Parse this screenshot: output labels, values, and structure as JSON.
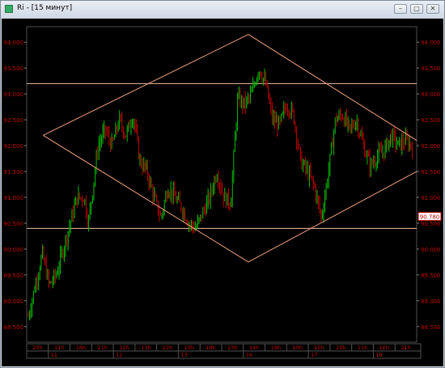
{
  "window": {
    "title": "Ri - [15 минут]",
    "minimize_glyph": "–",
    "maximize_glyph": "□",
    "close_glyph": "✕"
  },
  "chart_data": {
    "type": "candlestick",
    "yticks": [
      "94.000",
      "93.500",
      "93.000",
      "92.500",
      "92.000",
      "91.500",
      "91.000",
      "90.500",
      "90.000",
      "89.500",
      "89.000",
      "88.500"
    ],
    "ytick_values": [
      94000,
      93500,
      93000,
      92500,
      92000,
      91500,
      91000,
      90500,
      90000,
      89500,
      89000,
      88500
    ],
    "ylim": [
      88200,
      94300
    ],
    "current_price_label": "90.780",
    "current_price": 90.63,
    "time_labels": [
      "20h",
      "11h",
      "16h",
      "21h",
      "12h",
      "17h",
      "22h",
      "13h",
      "18h",
      "23h",
      "14h",
      "19h",
      "10h",
      "15h",
      "20h",
      "11h",
      "16h",
      "21h"
    ],
    "date_labels": [
      "11",
      "12",
      "13",
      "16",
      "17",
      "18"
    ],
    "horizontal_levels": [
      93200,
      90400
    ],
    "diamond": {
      "top": [
        23,
        94150
      ],
      "left": [
        0,
        92200
      ],
      "bottom": [
        23,
        89750
      ],
      "right": [
        46,
        92150
      ]
    },
    "trendlines": [
      {
        "from": [
          2,
          92200
        ],
        "to": [
          27,
          94150
        ]
      },
      {
        "from": [
          27,
          94150
        ],
        "to": [
          47.5,
          92100
        ]
      },
      {
        "from": [
          2,
          92200
        ],
        "to": [
          27,
          89750
        ]
      },
      {
        "from": [
          27,
          89750
        ],
        "to": [
          47.5,
          91500
        ]
      }
    ],
    "colors": {
      "up": "#00c000",
      "down": "#c00000",
      "axis_text": "#c00000",
      "lines": "#f0a080",
      "level_lines": "#f0c0a0",
      "background": "#000000"
    }
  }
}
